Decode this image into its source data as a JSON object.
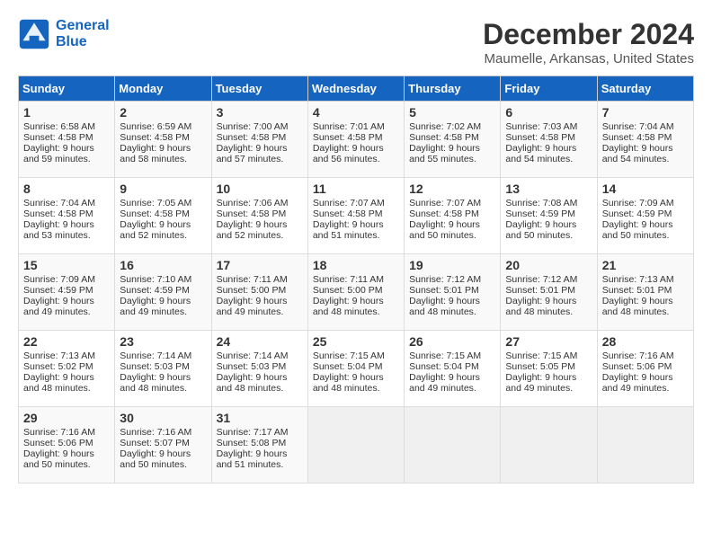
{
  "header": {
    "logo_line1": "General",
    "logo_line2": "Blue",
    "month": "December 2024",
    "location": "Maumelle, Arkansas, United States"
  },
  "weekdays": [
    "Sunday",
    "Monday",
    "Tuesday",
    "Wednesday",
    "Thursday",
    "Friday",
    "Saturday"
  ],
  "weeks": [
    [
      {
        "day": "1",
        "lines": [
          "Sunrise: 6:58 AM",
          "Sunset: 4:58 PM",
          "Daylight: 9 hours",
          "and 59 minutes."
        ]
      },
      {
        "day": "2",
        "lines": [
          "Sunrise: 6:59 AM",
          "Sunset: 4:58 PM",
          "Daylight: 9 hours",
          "and 58 minutes."
        ]
      },
      {
        "day": "3",
        "lines": [
          "Sunrise: 7:00 AM",
          "Sunset: 4:58 PM",
          "Daylight: 9 hours",
          "and 57 minutes."
        ]
      },
      {
        "day": "4",
        "lines": [
          "Sunrise: 7:01 AM",
          "Sunset: 4:58 PM",
          "Daylight: 9 hours",
          "and 56 minutes."
        ]
      },
      {
        "day": "5",
        "lines": [
          "Sunrise: 7:02 AM",
          "Sunset: 4:58 PM",
          "Daylight: 9 hours",
          "and 55 minutes."
        ]
      },
      {
        "day": "6",
        "lines": [
          "Sunrise: 7:03 AM",
          "Sunset: 4:58 PM",
          "Daylight: 9 hours",
          "and 54 minutes."
        ]
      },
      {
        "day": "7",
        "lines": [
          "Sunrise: 7:04 AM",
          "Sunset: 4:58 PM",
          "Daylight: 9 hours",
          "and 54 minutes."
        ]
      }
    ],
    [
      {
        "day": "8",
        "lines": [
          "Sunrise: 7:04 AM",
          "Sunset: 4:58 PM",
          "Daylight: 9 hours",
          "and 53 minutes."
        ]
      },
      {
        "day": "9",
        "lines": [
          "Sunrise: 7:05 AM",
          "Sunset: 4:58 PM",
          "Daylight: 9 hours",
          "and 52 minutes."
        ]
      },
      {
        "day": "10",
        "lines": [
          "Sunrise: 7:06 AM",
          "Sunset: 4:58 PM",
          "Daylight: 9 hours",
          "and 52 minutes."
        ]
      },
      {
        "day": "11",
        "lines": [
          "Sunrise: 7:07 AM",
          "Sunset: 4:58 PM",
          "Daylight: 9 hours",
          "and 51 minutes."
        ]
      },
      {
        "day": "12",
        "lines": [
          "Sunrise: 7:07 AM",
          "Sunset: 4:58 PM",
          "Daylight: 9 hours",
          "and 50 minutes."
        ]
      },
      {
        "day": "13",
        "lines": [
          "Sunrise: 7:08 AM",
          "Sunset: 4:59 PM",
          "Daylight: 9 hours",
          "and 50 minutes."
        ]
      },
      {
        "day": "14",
        "lines": [
          "Sunrise: 7:09 AM",
          "Sunset: 4:59 PM",
          "Daylight: 9 hours",
          "and 50 minutes."
        ]
      }
    ],
    [
      {
        "day": "15",
        "lines": [
          "Sunrise: 7:09 AM",
          "Sunset: 4:59 PM",
          "Daylight: 9 hours",
          "and 49 minutes."
        ]
      },
      {
        "day": "16",
        "lines": [
          "Sunrise: 7:10 AM",
          "Sunset: 4:59 PM",
          "Daylight: 9 hours",
          "and 49 minutes."
        ]
      },
      {
        "day": "17",
        "lines": [
          "Sunrise: 7:11 AM",
          "Sunset: 5:00 PM",
          "Daylight: 9 hours",
          "and 49 minutes."
        ]
      },
      {
        "day": "18",
        "lines": [
          "Sunrise: 7:11 AM",
          "Sunset: 5:00 PM",
          "Daylight: 9 hours",
          "and 48 minutes."
        ]
      },
      {
        "day": "19",
        "lines": [
          "Sunrise: 7:12 AM",
          "Sunset: 5:01 PM",
          "Daylight: 9 hours",
          "and 48 minutes."
        ]
      },
      {
        "day": "20",
        "lines": [
          "Sunrise: 7:12 AM",
          "Sunset: 5:01 PM",
          "Daylight: 9 hours",
          "and 48 minutes."
        ]
      },
      {
        "day": "21",
        "lines": [
          "Sunrise: 7:13 AM",
          "Sunset: 5:01 PM",
          "Daylight: 9 hours",
          "and 48 minutes."
        ]
      }
    ],
    [
      {
        "day": "22",
        "lines": [
          "Sunrise: 7:13 AM",
          "Sunset: 5:02 PM",
          "Daylight: 9 hours",
          "and 48 minutes."
        ]
      },
      {
        "day": "23",
        "lines": [
          "Sunrise: 7:14 AM",
          "Sunset: 5:03 PM",
          "Daylight: 9 hours",
          "and 48 minutes."
        ]
      },
      {
        "day": "24",
        "lines": [
          "Sunrise: 7:14 AM",
          "Sunset: 5:03 PM",
          "Daylight: 9 hours",
          "and 48 minutes."
        ]
      },
      {
        "day": "25",
        "lines": [
          "Sunrise: 7:15 AM",
          "Sunset: 5:04 PM",
          "Daylight: 9 hours",
          "and 48 minutes."
        ]
      },
      {
        "day": "26",
        "lines": [
          "Sunrise: 7:15 AM",
          "Sunset: 5:04 PM",
          "Daylight: 9 hours",
          "and 49 minutes."
        ]
      },
      {
        "day": "27",
        "lines": [
          "Sunrise: 7:15 AM",
          "Sunset: 5:05 PM",
          "Daylight: 9 hours",
          "and 49 minutes."
        ]
      },
      {
        "day": "28",
        "lines": [
          "Sunrise: 7:16 AM",
          "Sunset: 5:06 PM",
          "Daylight: 9 hours",
          "and 49 minutes."
        ]
      }
    ],
    [
      {
        "day": "29",
        "lines": [
          "Sunrise: 7:16 AM",
          "Sunset: 5:06 PM",
          "Daylight: 9 hours",
          "and 50 minutes."
        ]
      },
      {
        "day": "30",
        "lines": [
          "Sunrise: 7:16 AM",
          "Sunset: 5:07 PM",
          "Daylight: 9 hours",
          "and 50 minutes."
        ]
      },
      {
        "day": "31",
        "lines": [
          "Sunrise: 7:17 AM",
          "Sunset: 5:08 PM",
          "Daylight: 9 hours",
          "and 51 minutes."
        ]
      },
      null,
      null,
      null,
      null
    ]
  ]
}
